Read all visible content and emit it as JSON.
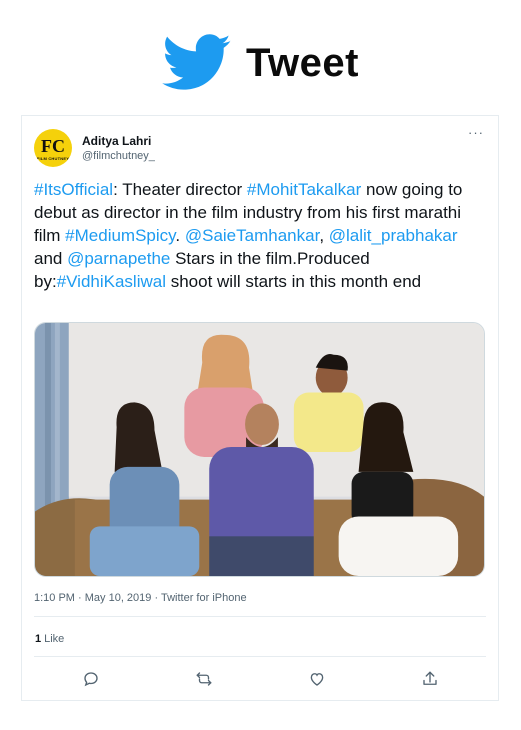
{
  "header": {
    "logo_icon": "twitter-bird-icon",
    "title": "Tweet",
    "brand_color": "#1d9bf0"
  },
  "author": {
    "avatar_text": "FC",
    "avatar_subtext": "FILM CHUTNEY",
    "display_name": "Aditya Lahri",
    "handle": "@filmchutney_"
  },
  "tweet": {
    "segments": [
      {
        "text": "#ItsOfficial",
        "link": true
      },
      {
        "text": ": Theater director  ",
        "link": false
      },
      {
        "text": "#MohitTakalkar",
        "link": true
      },
      {
        "text": " now going to debut as director in the film industry from his first marathi film ",
        "link": false
      },
      {
        "text": "#MediumSpicy",
        "link": true
      },
      {
        "text": ". ",
        "link": false
      },
      {
        "text": "@SaieTamhankar",
        "link": true
      },
      {
        "text": ", ",
        "link": false
      },
      {
        "text": "@lalit_prabhakar",
        "link": true
      },
      {
        "text": " and ",
        "link": false
      },
      {
        "text": "@parnapethe",
        "link": true
      },
      {
        "text": " Stars in the film.Produced by:",
        "link": false
      },
      {
        "text": "#VidhiKasliwal",
        "link": true
      },
      {
        "text": " shoot will starts in this month end",
        "link": false
      }
    ],
    "timestamp": "1:10 PM · May 10, 2019 · Twitter for iPhone",
    "likes_count": "1",
    "likes_label": "Like"
  },
  "actions": [
    {
      "icon": "reply-icon"
    },
    {
      "icon": "retweet-icon"
    },
    {
      "icon": "like-heart-icon"
    },
    {
      "icon": "share-icon"
    }
  ]
}
